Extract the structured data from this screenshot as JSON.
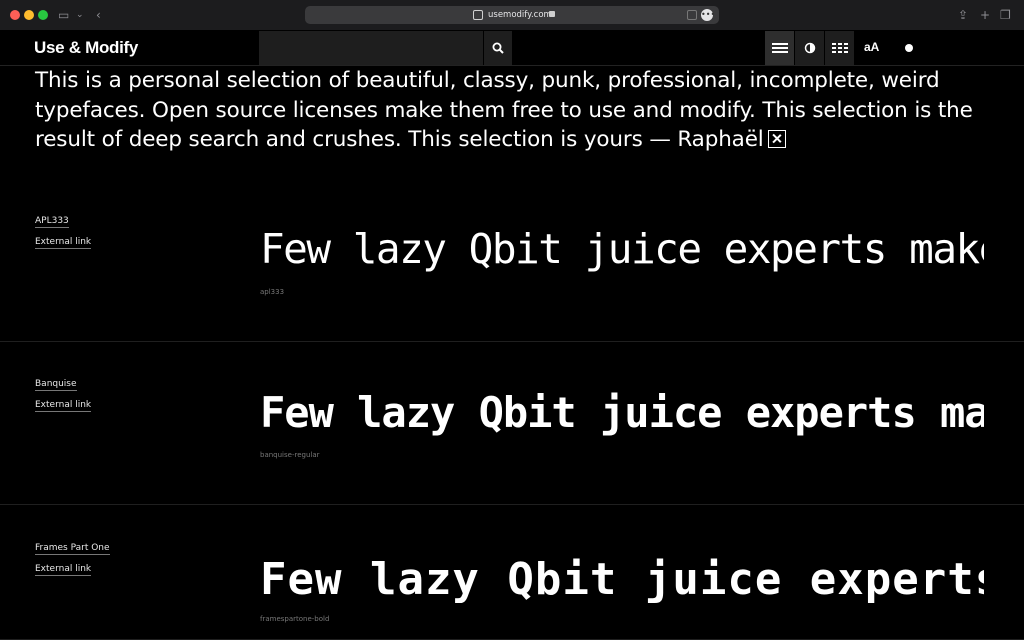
{
  "browser": {
    "url": "usemodify.com"
  },
  "header": {
    "logo": "Use & Modify",
    "search_placeholder": "",
    "accent_bg": "#1e1e1e",
    "size_toggle_label": "aA"
  },
  "intro": {
    "text": "This is a personal selection of beautiful, classy, punk, professional, incomplete, weird typefaces. Open source licenses make them free to use and modify. This selection is the result of deep search and crushes. This selection is yours — Raphaël"
  },
  "fonts": [
    {
      "name": "APL333",
      "link": "External link",
      "sample": "Few lazy Qbit juice experts make do",
      "id": "apl333"
    },
    {
      "name": "Banquise",
      "link": "External link",
      "sample": "Few lazy Qbit juice experts make do",
      "id": "banquise-regular"
    },
    {
      "name": "Frames Part One",
      "link": "External link",
      "sample": "Few lazy Qbit juice experts make do",
      "id": "framespartone-bold"
    }
  ]
}
